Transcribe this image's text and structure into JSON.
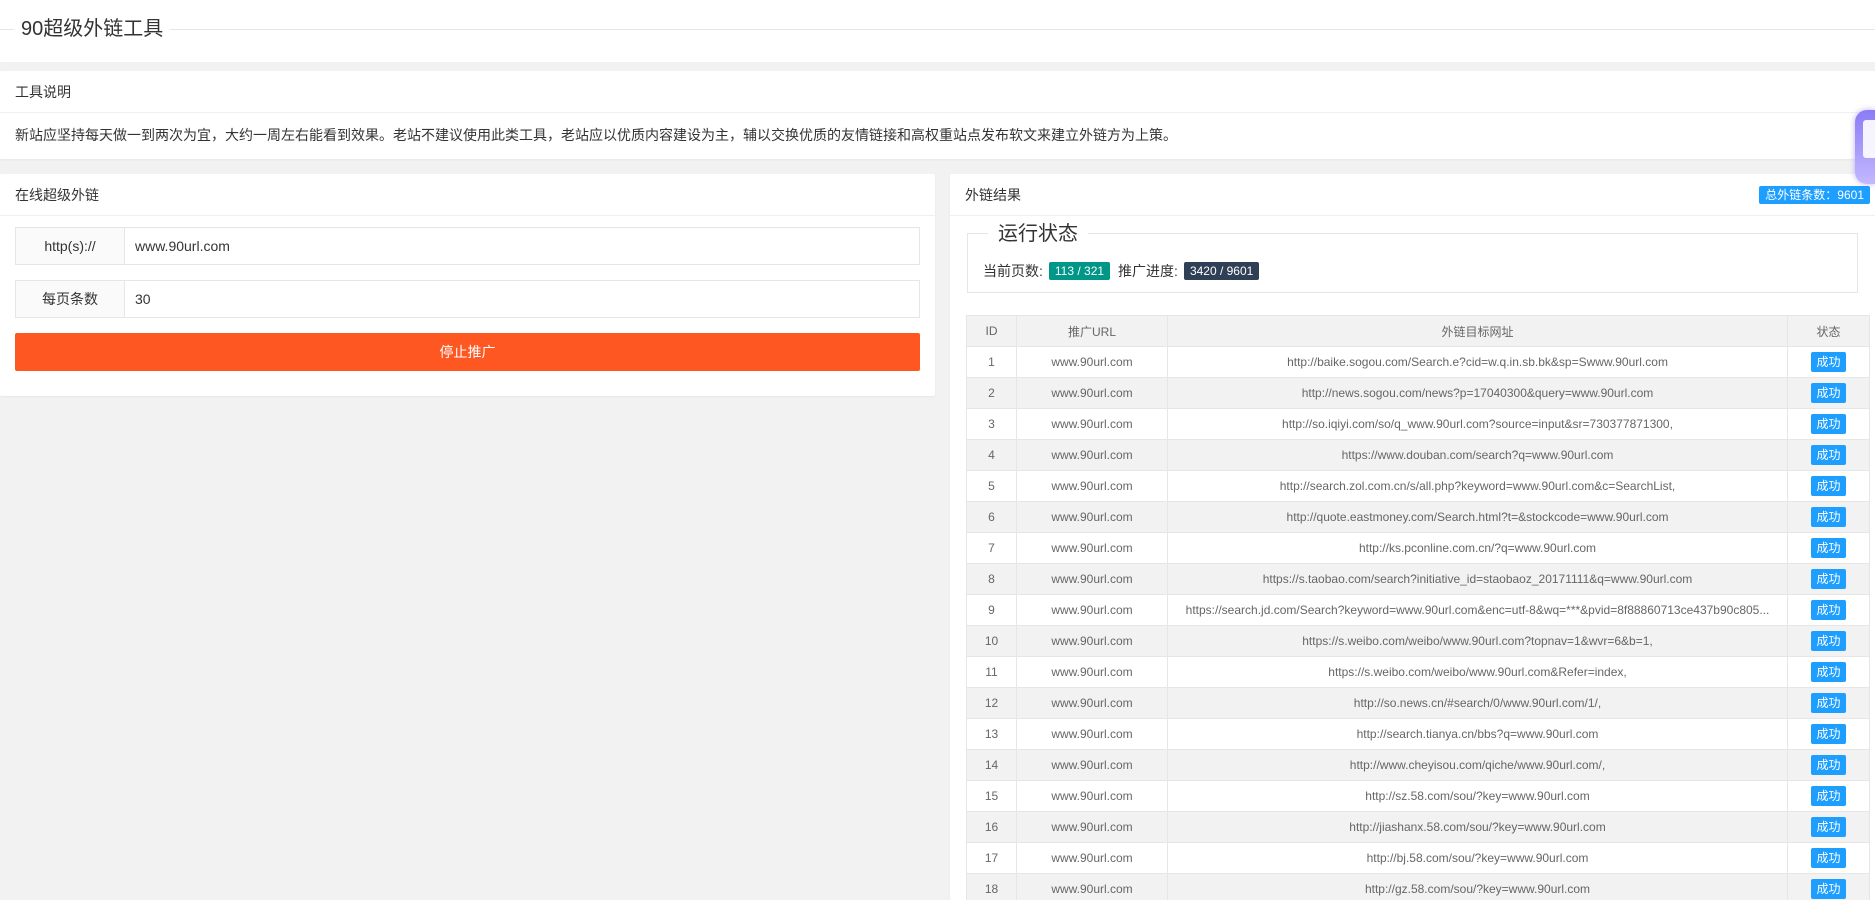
{
  "page": {
    "title": "90超级外链工具"
  },
  "description": {
    "header": "工具说明",
    "text": "新站应坚持每天做一到两次为宜，大约一周左右能看到效果。老站不建议使用此类工具，老站应以优质内容建设为主，辅以交换优质的友情链接和高权重站点发布软文来建立外链方为上策。"
  },
  "online_tool": {
    "header": "在线超级外链",
    "url_label": "http(s)://",
    "url_value": "www.90url.com",
    "per_page_label": "每页条数",
    "per_page_value": "30",
    "stop_button": "停止推广"
  },
  "results": {
    "header": "外链结果",
    "total_badge": "总外链条数：9601",
    "status_title": "运行状态",
    "current_page_label": "当前页数:",
    "current_page_value": "113 / 321",
    "progress_label": "推广进度:",
    "progress_value": "3420 / 9601",
    "columns": [
      "ID",
      "推广URL",
      "外链目标网址",
      "状态"
    ],
    "rows": [
      [
        "1",
        "www.90url.com",
        "http://baike.sogou.com/Search.e?cid=w.q.in.sb.bk&sp=Swww.90url.com",
        "成功"
      ],
      [
        "2",
        "www.90url.com",
        "http://news.sogou.com/news?p=17040300&query=www.90url.com",
        "成功"
      ],
      [
        "3",
        "www.90url.com",
        "http://so.iqiyi.com/so/q_www.90url.com?source=input&sr=730377871300,",
        "成功"
      ],
      [
        "4",
        "www.90url.com",
        "https://www.douban.com/search?q=www.90url.com",
        "成功"
      ],
      [
        "5",
        "www.90url.com",
        "http://search.zol.com.cn/s/all.php?keyword=www.90url.com&c=SearchList,",
        "成功"
      ],
      [
        "6",
        "www.90url.com",
        "http://quote.eastmoney.com/Search.html?t=&stockcode=www.90url.com",
        "成功"
      ],
      [
        "7",
        "www.90url.com",
        "http://ks.pconline.com.cn/?q=www.90url.com",
        "成功"
      ],
      [
        "8",
        "www.90url.com",
        "https://s.taobao.com/search?initiative_id=staobaoz_20171111&q=www.90url.com",
        "成功"
      ],
      [
        "9",
        "www.90url.com",
        "https://search.jd.com/Search?keyword=www.90url.com&enc=utf-8&wq=***&pvid=8f88860713ce437b90c805...",
        "成功"
      ],
      [
        "10",
        "www.90url.com",
        "https://s.weibo.com/weibo/www.90url.com?topnav=1&wvr=6&b=1,",
        "成功"
      ],
      [
        "11",
        "www.90url.com",
        "https://s.weibo.com/weibo/www.90url.com&Refer=index,",
        "成功"
      ],
      [
        "12",
        "www.90url.com",
        "http://so.news.cn/#search/0/www.90url.com/1/,",
        "成功"
      ],
      [
        "13",
        "www.90url.com",
        "http://search.tianya.cn/bbs?q=www.90url.com",
        "成功"
      ],
      [
        "14",
        "www.90url.com",
        "http://www.cheyisou.com/qiche/www.90url.com/,",
        "成功"
      ],
      [
        "15",
        "www.90url.com",
        "http://sz.58.com/sou/?key=www.90url.com",
        "成功"
      ],
      [
        "16",
        "www.90url.com",
        "http://jiashanx.58.com/sou/?key=www.90url.com",
        "成功"
      ],
      [
        "17",
        "www.90url.com",
        "http://bj.58.com/sou/?key=www.90url.com",
        "成功"
      ],
      [
        "18",
        "www.90url.com",
        "http://gz.58.com/sou/?key=www.90url.com",
        "成功"
      ]
    ]
  }
}
